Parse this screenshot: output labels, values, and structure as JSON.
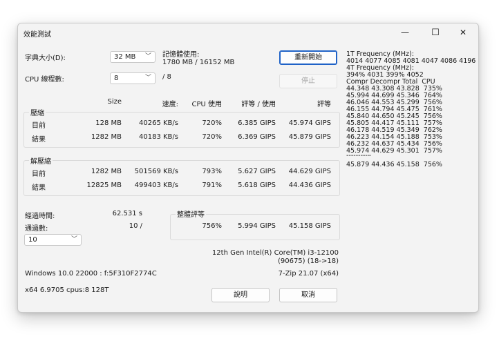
{
  "window": {
    "title": "效能測試",
    "minimize_glyph": "—",
    "maximize_glyph": "☐",
    "close_glyph": "✕"
  },
  "settings": {
    "dict_label": "字典大小(D):",
    "dict_value": "32 MB",
    "threads_label": "CPU 線程數:",
    "threads_value": "8",
    "threads_max": "/ 8",
    "memory_label": "記憶體使用:",
    "memory_value": "1780 MB / 16152 MB"
  },
  "buttons": {
    "restart": "重新開始",
    "stop": "停止",
    "help": "說明",
    "cancel": "取消"
  },
  "table": {
    "headers": [
      "Size",
      "速度:",
      "CPU 使用",
      "評等 / 使用",
      "評等"
    ],
    "compress_label": "壓縮",
    "decompress_label": "解壓縮",
    "compress_rows": [
      {
        "label": "目前",
        "size": "128 MB",
        "speed": "40265 KB/s",
        "cpu": "720%",
        "rating_usage": "6.385 GIPS",
        "rating": "45.974 GIPS"
      },
      {
        "label": "結果",
        "size": "1282 MB",
        "speed": "40183 KB/s",
        "cpu": "720%",
        "rating_usage": "6.369 GIPS",
        "rating": "45.879 GIPS"
      }
    ],
    "decompress_rows": [
      {
        "label": "目前",
        "size": "1282 MB",
        "speed": "501569 KB/s",
        "cpu": "793%",
        "rating_usage": "5.627 GIPS",
        "rating": "44.629 GIPS"
      },
      {
        "label": "結果",
        "size": "12825 MB",
        "speed": "499403 KB/s",
        "cpu": "791%",
        "rating_usage": "5.618 GIPS",
        "rating": "44.436 GIPS"
      }
    ]
  },
  "status": {
    "elapsed_label": "經過時間:",
    "elapsed_value": "62.531 s",
    "passes_label": "通過數:",
    "passes_value": "10 /",
    "passes_select": "10"
  },
  "total": {
    "label": "整體評等",
    "cpu": "756%",
    "rating_usage": "5.994 GIPS",
    "rating": "45.158 GIPS"
  },
  "cpu_info": {
    "line1": "12th Gen Intel(R) Core(TM) i3-12100",
    "line2": "(90675) (18->18)"
  },
  "footer": {
    "os": "Windows 10.0 22000 : f:5F310F2774C",
    "version": "7-Zip 21.07 (x64)",
    "arch": "x64 6.9705 cpus:8 128T"
  },
  "freq": {
    "f1_label": "1T Frequency (MHz):",
    "f1_values": "4014 4077 4085 4081 4047 4086 4196",
    "f4_label": "4T Frequency (MHz):",
    "f4_values": "394% 4031 399% 4052",
    "header": "Compr Decompr Total  CPU",
    "rows": [
      "44.348 43.308 43.828  735%",
      "45.994 44.699 45.346  764%",
      "46.046 44.553 45.299  756%",
      "46.155 44.794 45.475  761%",
      "45.840 44.650 45.245  756%",
      "45.805 44.417 45.111  757%",
      "46.178 44.519 45.349  762%",
      "46.223 44.154 45.188  753%",
      "46.232 44.637 45.434  756%",
      "45.974 44.629 45.301  757%"
    ],
    "separator": "------------------------------",
    "summary": "45.879 44.436 45.158  756%"
  }
}
